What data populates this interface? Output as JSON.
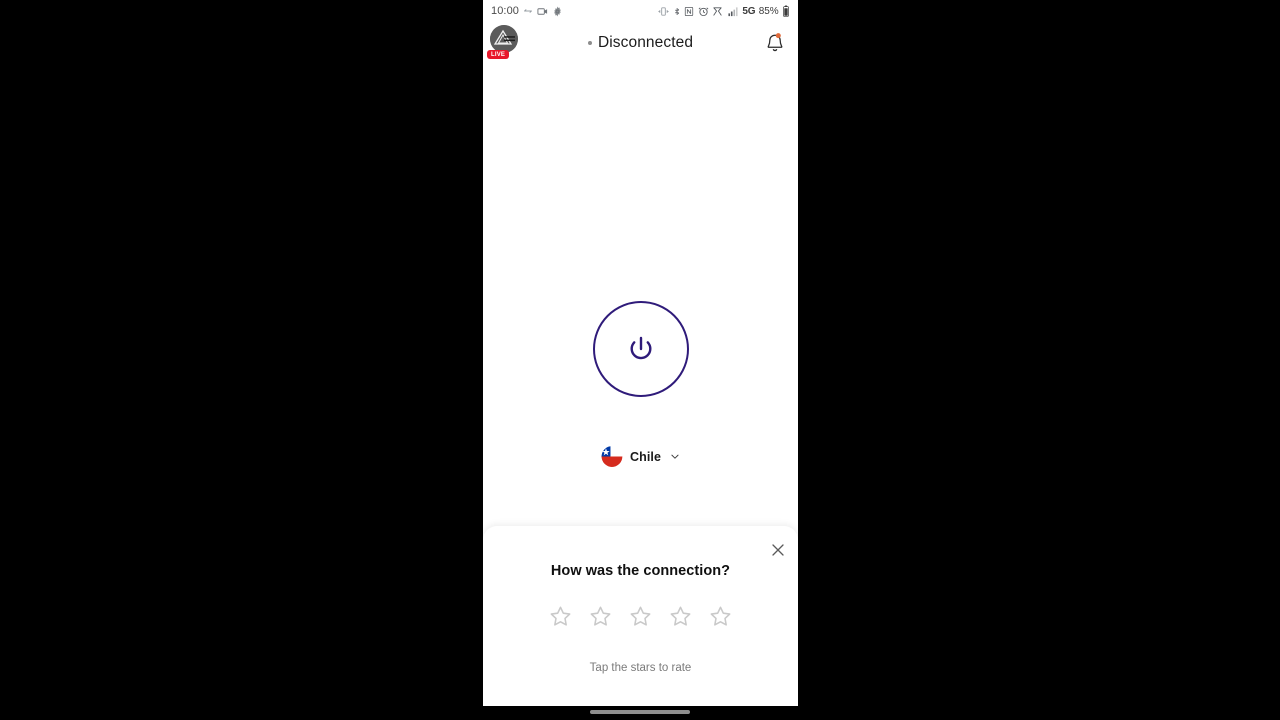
{
  "status_bar": {
    "time": "10:00",
    "left_icons": [
      "link-icon",
      "screen-record-icon",
      "gear-icon"
    ],
    "right_icons": [
      "vibrate-icon",
      "bluetooth-icon",
      "nfc-icon",
      "alarm-icon",
      "data-saver-icon",
      "signal-bars-icon"
    ],
    "network": "5G",
    "battery_percent": "85%"
  },
  "header": {
    "status_label": "Disconnected",
    "avatar_badge": "LIVE",
    "avatar_icon": "pyramid-avatar-icon",
    "bell_icon": "bell-icon",
    "status_dot_color": "#8d8d8d"
  },
  "main": {
    "power_button_label": "power-button",
    "power_color": "#2f1b7a",
    "country": "Chile",
    "country_flag": "chile-flag-icon",
    "chevron_icon": "chevron-down-icon"
  },
  "sheet": {
    "title": "How was the connection?",
    "hint": "Tap the stars to rate",
    "close_icon": "close-icon",
    "rating": 0,
    "max_rating": 5,
    "star_color": "#c9c9c9"
  }
}
